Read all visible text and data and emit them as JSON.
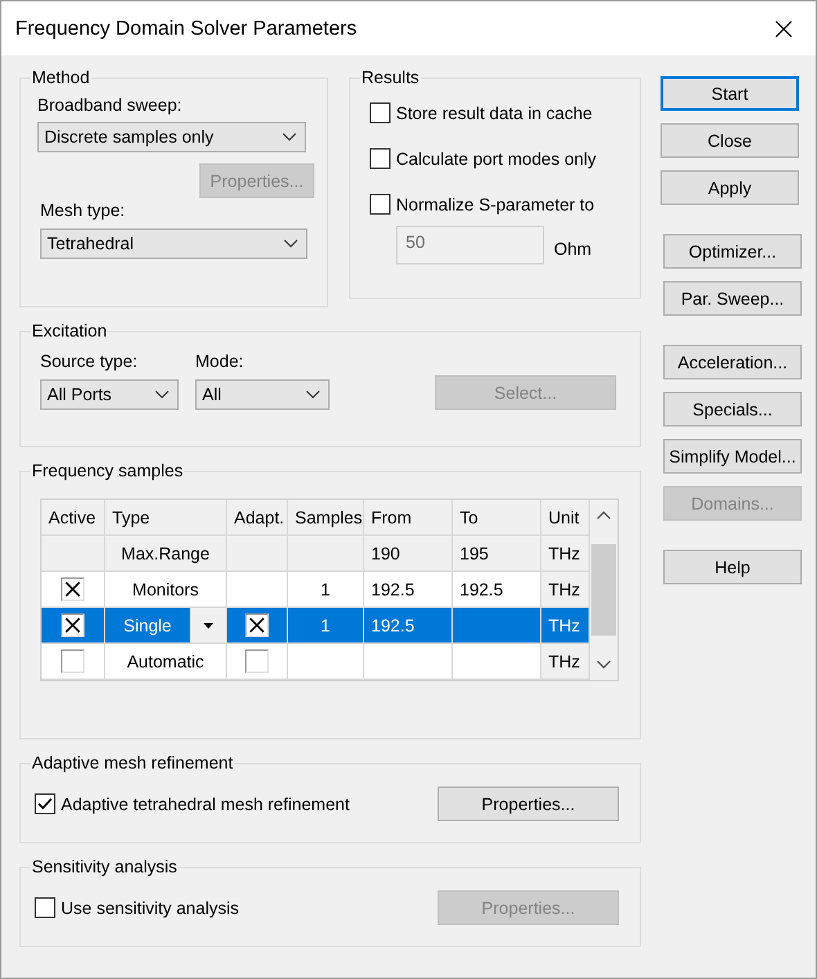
{
  "window": {
    "title": "Frequency Domain Solver Parameters"
  },
  "method": {
    "title": "Method",
    "broadband_label": "Broadband sweep:",
    "broadband_value": "Discrete samples only",
    "properties_button": {
      "label": "Properties...",
      "disabled": true
    },
    "mesh_label": "Mesh type:",
    "mesh_value": "Tetrahedral"
  },
  "results": {
    "title": "Results",
    "options": [
      {
        "label": "Store result data in cache",
        "checked": false
      },
      {
        "label": "Calculate port modes only",
        "checked": false
      },
      {
        "label": "Normalize S-parameter to",
        "checked": false
      }
    ],
    "impedance": {
      "value": "50",
      "disabled": true
    },
    "unit": "Ohm"
  },
  "excitation": {
    "title": "Excitation",
    "source_label": "Source type:",
    "source_value": "All Ports",
    "mode_label": "Mode:",
    "mode_value": "All",
    "select_button": {
      "label": "Select...",
      "disabled": true
    }
  },
  "frequency_samples": {
    "title": "Frequency samples",
    "table": {
      "columns": [
        "Active",
        "Type",
        "Adapt.",
        "Samples",
        "From",
        "To",
        "Unit"
      ],
      "rows": [
        {
          "kind": "range",
          "selected": false,
          "type": "Max.Range",
          "from": "190",
          "to": "195",
          "unit": "THz"
        },
        {
          "kind": "sample",
          "selected": false,
          "active": true,
          "type": "Monitors",
          "samples": "1",
          "from": "192.5",
          "to": "192.5",
          "unit": "THz"
        },
        {
          "kind": "sample",
          "selected": true,
          "active": true,
          "type": "Single",
          "adaptive": true,
          "samples": "1",
          "from": "192.5",
          "unit": "THz"
        },
        {
          "kind": "sample",
          "selected": false,
          "active": false,
          "type": "Automatic",
          "adaptive": false,
          "unit": "THz"
        }
      ]
    }
  },
  "adaptive_mesh": {
    "title": "Adaptive mesh refinement",
    "option": {
      "label": "Adaptive tetrahedral mesh refinement",
      "checked": true
    },
    "properties_button": {
      "label": "Properties...",
      "disabled": false
    }
  },
  "sensitivity": {
    "title": "Sensitivity analysis",
    "option": {
      "label": "Use sensitivity analysis",
      "checked": false
    },
    "properties_button": {
      "label": "Properties...",
      "disabled": true
    }
  },
  "buttons": [
    [
      {
        "label": "Start",
        "default": true,
        "disabled": false
      },
      {
        "label": "Close",
        "default": false,
        "disabled": false
      },
      {
        "label": "Apply",
        "default": false,
        "disabled": false
      }
    ],
    [
      {
        "label": "Optimizer...",
        "default": false,
        "disabled": false
      },
      {
        "label": "Par. Sweep...",
        "default": false,
        "disabled": false
      }
    ],
    [
      {
        "label": "Acceleration...",
        "default": false,
        "disabled": false
      },
      {
        "label": "Specials...",
        "default": false,
        "disabled": false
      },
      {
        "label": "Simplify Model...",
        "default": false,
        "disabled": false
      },
      {
        "label": "Domains...",
        "default": false,
        "disabled": true
      }
    ],
    [
      {
        "label": "Help",
        "default": false,
        "disabled": false
      }
    ]
  ]
}
